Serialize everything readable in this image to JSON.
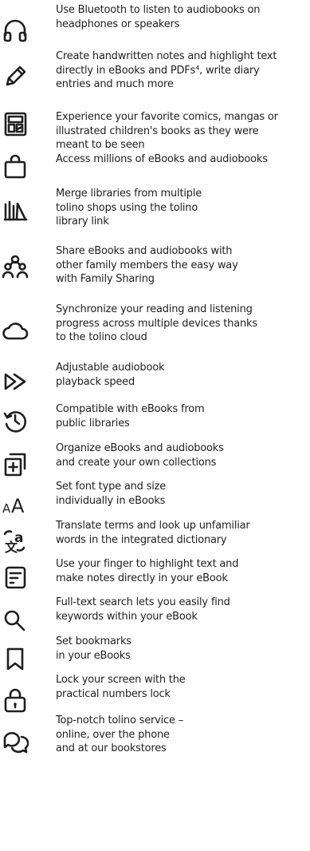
{
  "features": [
    {
      "icon": "headphones-icon",
      "text": "Use Bluetooth to listen to audiobooks on\nheadphones or speakers"
    },
    {
      "icon": "pen-icon",
      "text": "Create handwritten notes and highlight text\ndirectly in eBooks and PDFs⁴, write diary\nentries and much more"
    },
    {
      "icon": "comic-icon",
      "text": "Experience your favorite comics, mangas or\nillustrated children's books as they were\nmeant to be seen"
    },
    {
      "icon": "shopping-bag-icon",
      "text": "Access millions of eBooks and audiobooks"
    },
    {
      "icon": "library-icon",
      "text": "Merge libraries from multiple\ntolino shops using the tolino\nlibrary link"
    },
    {
      "icon": "family-icon",
      "text": "Share eBooks and audiobooks with\nother family members the easy way\nwith Family Sharing"
    },
    {
      "icon": "cloud-icon",
      "text": "Synchronize your reading and listening\nprogress across multiple devices thanks\nto the tolino cloud"
    },
    {
      "icon": "fast-forward-icon",
      "text": "Adjustable audiobook\nplayback speed"
    },
    {
      "icon": "history-icon",
      "text": "Compatible with eBooks from\npublic libraries"
    },
    {
      "icon": "collection-add-icon",
      "text": "Organize eBooks and audiobooks\nand create your own collections"
    },
    {
      "icon": "font-size-icon",
      "text": "Set font type and size\nindividually in eBooks"
    },
    {
      "icon": "translate-icon",
      "text": "Translate terms and look up unfamiliar\nwords in the integrated dictionary"
    },
    {
      "icon": "note-icon",
      "text": "Use your finger to highlight text and\nmake notes directly in your eBook"
    },
    {
      "icon": "search-icon",
      "text": "Full-text search lets you easily find\nkeywords within your eBook"
    },
    {
      "icon": "bookmark-icon",
      "text": "Set bookmarks\nin your eBooks"
    },
    {
      "icon": "lock-icon",
      "text": "Lock your screen with the\npractical numbers lock"
    },
    {
      "icon": "chat-icon",
      "text": "Top-notch tolino service –\nonline, over the phone\nand at our bookstores"
    }
  ]
}
